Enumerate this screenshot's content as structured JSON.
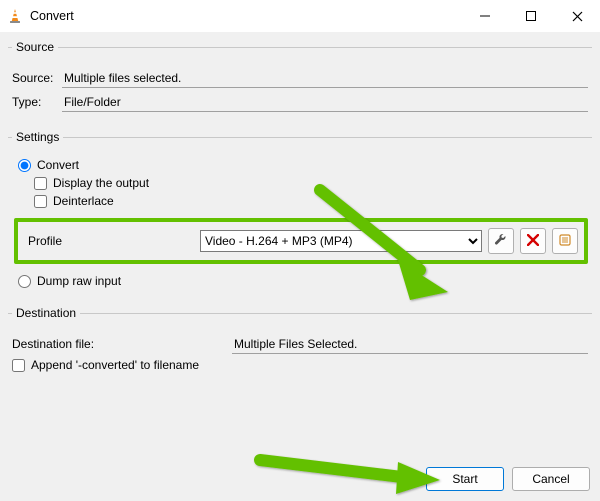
{
  "window": {
    "title": "Convert"
  },
  "source": {
    "legend": "Source",
    "source_label": "Source:",
    "source_value": "Multiple files selected.",
    "type_label": "Type:",
    "type_value": "File/Folder"
  },
  "settings": {
    "legend": "Settings",
    "convert_label": "Convert",
    "display_output_label": "Display the output",
    "deinterlace_label": "Deinterlace",
    "profile_label": "Profile",
    "profile_value": "Video - H.264 + MP3 (MP4)",
    "dump_raw_label": "Dump raw input"
  },
  "destination": {
    "legend": "Destination",
    "file_label": "Destination file:",
    "file_value": "Multiple Files Selected.",
    "append_label": "Append '-converted' to filename"
  },
  "buttons": {
    "start": "Start",
    "cancel": "Cancel"
  },
  "colors": {
    "highlight": "#63c000",
    "accent": "#0078d7"
  }
}
